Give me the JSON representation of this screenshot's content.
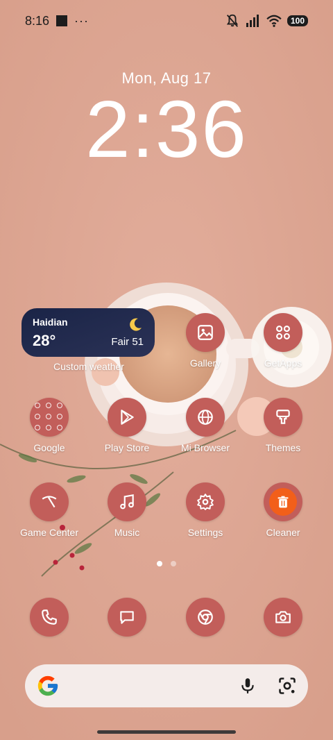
{
  "status_bar": {
    "time": "8:16",
    "more": "···",
    "battery": "100"
  },
  "lockscreen": {
    "date": "Mon, Aug 17",
    "time": "2:36"
  },
  "weather_widget": {
    "city": "Haidian",
    "temperature": "28°",
    "condition": "Fair 51",
    "label": "Custom weather"
  },
  "apps_row1": [
    {
      "label": "Gallery",
      "icon": "gallery-icon"
    },
    {
      "label": "GetApps",
      "icon": "getapps-icon"
    }
  ],
  "apps_row2": [
    {
      "label": "Google",
      "icon": "google-folder-icon"
    },
    {
      "label": "Play Store",
      "icon": "play-store-icon"
    },
    {
      "label": "Mi Browser",
      "icon": "globe-icon"
    },
    {
      "label": "Themes",
      "icon": "paint-brush-icon"
    }
  ],
  "apps_row3": [
    {
      "label": "Game Center",
      "icon": "game-icon"
    },
    {
      "label": "Music",
      "icon": "music-note-icon"
    },
    {
      "label": "Settings",
      "icon": "gear-icon"
    },
    {
      "label": "Cleaner",
      "icon": "trash-icon"
    }
  ],
  "dock": [
    {
      "name": "phone",
      "icon": "phone-icon"
    },
    {
      "name": "messages",
      "icon": "message-icon"
    },
    {
      "name": "chrome",
      "icon": "chrome-icon"
    },
    {
      "name": "camera",
      "icon": "camera-icon"
    }
  ],
  "colors": {
    "wallpaper": "#dba390",
    "icon_bg": "#c25e5a",
    "widget_bg": "#1a2447",
    "cleaner_accent": "#f25f1a"
  }
}
